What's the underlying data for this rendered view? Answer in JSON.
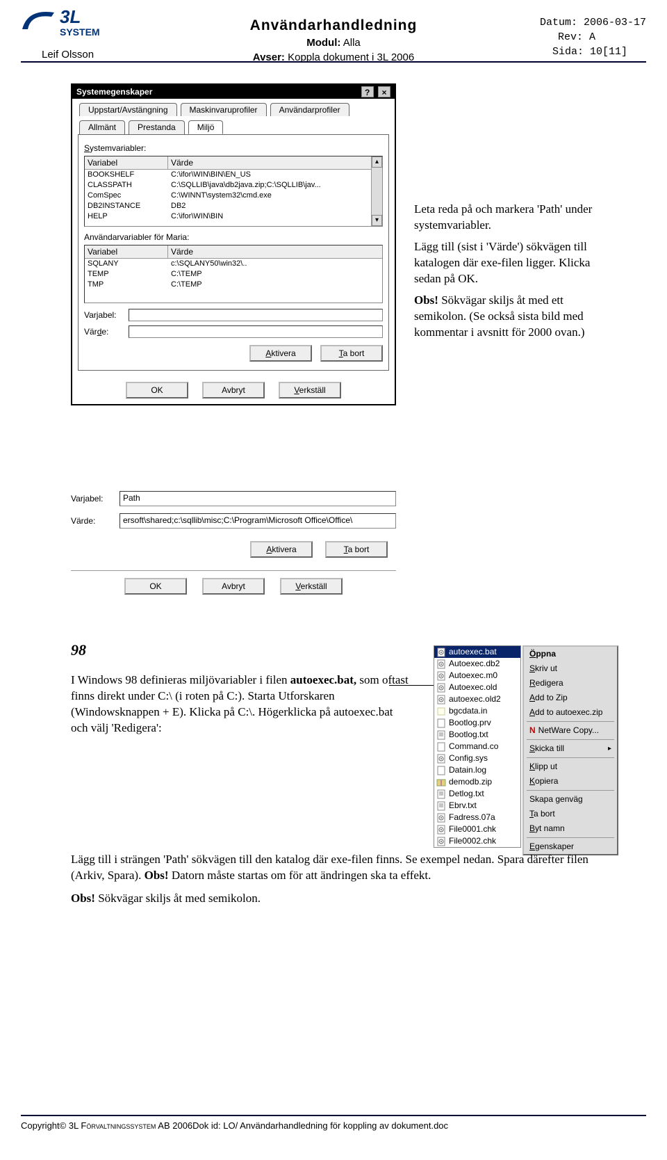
{
  "header": {
    "logo_top": "3L",
    "logo_bottom": "SYSTEM",
    "author": "Leif Olsson",
    "title": "Användarhandledning",
    "module_label": "Modul:",
    "module_value": "Alla",
    "subject_label": "Avser:",
    "subject_value": "Koppla dokument i 3L 2006",
    "date_label": "Datum:",
    "date_value": "2006-03-17",
    "rev_label": "Rev:",
    "rev_value": "A",
    "page_label": "Sida:",
    "page_value": "10[11]"
  },
  "dialog1": {
    "title": "Systemegenskaper",
    "help_btn": "?",
    "close_btn": "×",
    "tabs_row1": [
      "Uppstart/Avstängning",
      "Maskinvaruprofiler",
      "Användarprofiler"
    ],
    "tabs_row2": [
      "Allmänt",
      "Prestanda",
      "Miljö"
    ],
    "active_tab": "Miljö",
    "sysvars_label": "Systemvariabler:",
    "header_var": "Variabel",
    "header_val": "Värde",
    "sysvars": [
      {
        "k": "BOOKSHELF",
        "v": "C:\\ifor\\WIN\\BIN\\EN_US"
      },
      {
        "k": "CLASSPATH",
        "v": "C:\\SQLLIB\\java\\db2java.zip;C:\\SQLLIB\\jav..."
      },
      {
        "k": "ComSpec",
        "v": "C:\\WINNT\\system32\\cmd.exe"
      },
      {
        "k": "DB2INSTANCE",
        "v": "DB2"
      },
      {
        "k": "HELP",
        "v": "C:\\ifor\\WIN\\BIN"
      }
    ],
    "uservars_label": "Användarvariabler för Maria:",
    "uservars": [
      {
        "k": "SQLANY",
        "v": "c:\\SQLANY50\\win32\\.."
      },
      {
        "k": "TEMP",
        "v": "C:\\TEMP"
      },
      {
        "k": "TMP",
        "v": "C:\\TEMP"
      }
    ],
    "field_var": "Varjabel:",
    "field_val": "Värde:",
    "btn_activate": "Aktivera",
    "btn_remove": "Ta bort",
    "btn_ok": "OK",
    "btn_cancel": "Avbryt",
    "btn_apply": "Verkställ"
  },
  "annot1": {
    "p1": "Leta reda på och markera 'Path' under systemvariabler.",
    "p2": "Lägg till (sist i 'Värde') sökvägen till katalogen där exe-filen ligger. Klicka sedan på OK.",
    "p3_bold": "Obs!",
    "p3_rest": " Sökvägar skiljs åt med ett semikolon. (Se också sista bild med kommentar i avsnitt för 2000 ovan.)"
  },
  "dialog2": {
    "var_label": "Varjabel:",
    "var_value": "Path",
    "val_label": "Värde:",
    "val_value": "ersoft\\shared;c:\\sqllib\\misc;C:\\Program\\Microsoft Office\\Office\\",
    "btn_activate": "Aktivera",
    "btn_remove": "Ta bort",
    "btn_ok": "OK",
    "btn_cancel": "Avbryt",
    "btn_apply": "Verkställ"
  },
  "sec98": {
    "heading": "98",
    "body_pre": "I Windows 98 definieras miljövariabler i filen ",
    "body_bold": "autoexec.bat,",
    "body_post": " som oftast finns direkt under C:\\ (i roten på C:). Starta Utforskaren (Windowsknappen + E). Klicka på C:\\. Högerklicka på autoexec.bat och välj 'Redigera':"
  },
  "explorer": {
    "files": [
      {
        "name": "autoexec.bat",
        "selected": true,
        "icon": "gear"
      },
      {
        "name": "Autoexec.db2",
        "selected": false,
        "icon": "gear"
      },
      {
        "name": "Autoexec.m0",
        "selected": false,
        "icon": "gear"
      },
      {
        "name": "Autoexec.old",
        "selected": false,
        "icon": "gear"
      },
      {
        "name": "autoexec.old2",
        "selected": false,
        "icon": "gear"
      },
      {
        "name": "bgcdata.in",
        "selected": false,
        "icon": "note"
      },
      {
        "name": "Bootlog.prv",
        "selected": false,
        "icon": "doc"
      },
      {
        "name": "Bootlog.txt",
        "selected": false,
        "icon": "txt"
      },
      {
        "name": "Command.co",
        "selected": false,
        "icon": "doc"
      },
      {
        "name": "Config.sys",
        "selected": false,
        "icon": "gear"
      },
      {
        "name": "Datain.log",
        "selected": false,
        "icon": "doc"
      },
      {
        "name": "demodb.zip",
        "selected": false,
        "icon": "zip"
      },
      {
        "name": "Detlog.txt",
        "selected": false,
        "icon": "txt"
      },
      {
        "name": "Ebrv.txt",
        "selected": false,
        "icon": "txt"
      },
      {
        "name": "Fadress.07a",
        "selected": false,
        "icon": "gear"
      },
      {
        "name": "File0001.chk",
        "selected": false,
        "icon": "gear"
      },
      {
        "name": "File0002.chk",
        "selected": false,
        "icon": "gear"
      }
    ]
  },
  "ctxmenu": {
    "items": [
      {
        "label": "Öppna",
        "bold": true
      },
      {
        "label": "Skriv ut"
      },
      {
        "label": "Redigera"
      },
      {
        "label": "Add to Zip"
      },
      {
        "label": "Add to autoexec.zip"
      },
      {
        "sep": true
      },
      {
        "label": "NetWare Copy...",
        "prefix": "N"
      },
      {
        "sep": true
      },
      {
        "label": "Skicka till",
        "arrow": true
      },
      {
        "sep": true
      },
      {
        "label": "Klipp ut"
      },
      {
        "label": "Kopiera"
      },
      {
        "sep": true
      },
      {
        "label": "Skapa genväg"
      },
      {
        "label": "Ta bort"
      },
      {
        "label": "Byt namn"
      },
      {
        "sep": true
      },
      {
        "label": "Egenskaper"
      }
    ]
  },
  "bottom": {
    "p1_pre": "Lägg till i strängen 'Path' sökvägen till den katalog där exe-filen finns. Se exempel nedan. Spara därefter filen (Arkiv, Spara). ",
    "p1_bold": "Obs!",
    "p1_post": " Datorn måste startas om för att ändringen ska ta effekt.",
    "p2_bold": "Obs!",
    "p2_rest": " Sökvägar skiljs åt med semikolon."
  },
  "footer": {
    "left_pre": "Copyright© 3L ",
    "left_sc": "Förvaltningssystem",
    "left_post": " AB 2006",
    "mid": "Dok id: LO/ Användarhandledning för koppling av dokument.doc"
  }
}
